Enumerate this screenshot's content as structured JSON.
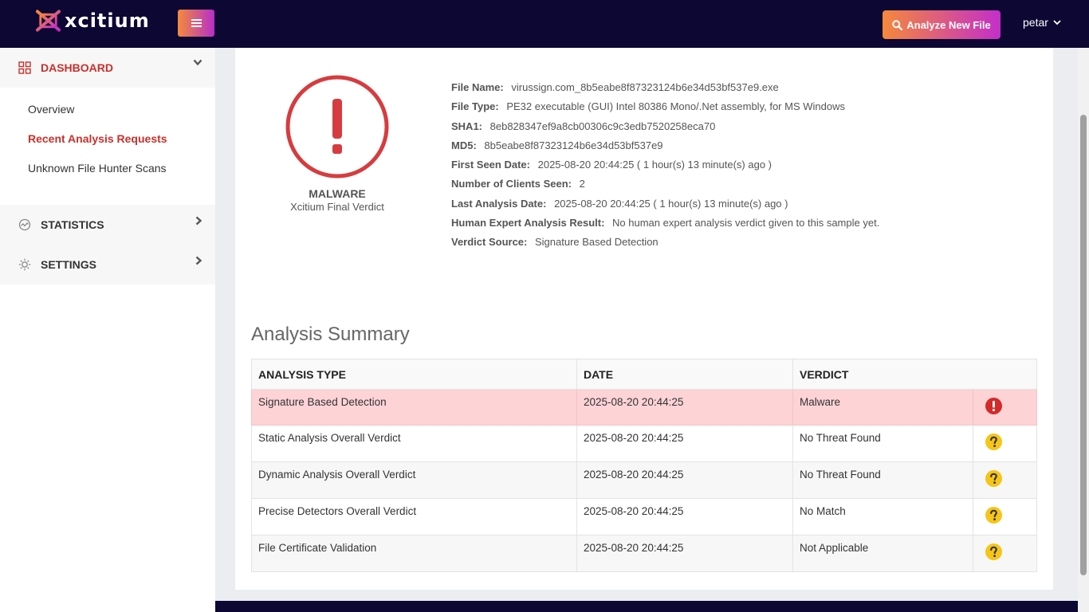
{
  "header": {
    "brand": "xcitium",
    "analyze_label": "Analyze New File",
    "user": "petar"
  },
  "sidebar": {
    "dashboard": "DASHBOARD",
    "items": [
      "Overview",
      "Recent Analysis Requests",
      "Unknown File Hunter Scans"
    ],
    "statistics": "STATISTICS",
    "settings": "SETTINGS"
  },
  "verdict": {
    "label": "MALWARE",
    "sub": "Xcitium Final Verdict"
  },
  "file_info": [
    {
      "label": "File Name:",
      "value": "virussign.com_8b5eabe8f87323124b6e34d53bf537e9.exe"
    },
    {
      "label": "File Type:",
      "value": "PE32 executable (GUI) Intel 80386 Mono/.Net assembly, for MS Windows"
    },
    {
      "label": "SHA1:",
      "value": "8eb828347ef9a8cb00306c9c3edb7520258eca70"
    },
    {
      "label": "MD5:",
      "value": "8b5eabe8f87323124b6e34d53bf537e9"
    },
    {
      "label": "First Seen Date:",
      "value": "2025-08-20 20:44:25 ( 1 hour(s) 13 minute(s) ago )"
    },
    {
      "label": "Number of Clients Seen:",
      "value": "2"
    },
    {
      "label": "Last Analysis Date:",
      "value": "2025-08-20 20:44:25 ( 1 hour(s) 13 minute(s) ago )"
    },
    {
      "label": "Human Expert Analysis Result:",
      "value": "No human expert analysis verdict given to this sample yet."
    },
    {
      "label": "Verdict Source:",
      "value": "Signature Based Detection"
    }
  ],
  "summary": {
    "title": "Analysis Summary",
    "columns": [
      "ANALYSIS TYPE",
      "DATE",
      "VERDICT"
    ],
    "rows": [
      {
        "type": "Signature Based Detection",
        "date": "2025-08-20 20:44:25",
        "verdict": "Malware"
      },
      {
        "type": "Static Analysis Overall Verdict",
        "date": "2025-08-20 20:44:25",
        "verdict": "No Threat Found"
      },
      {
        "type": "Dynamic Analysis Overall Verdict",
        "date": "2025-08-20 20:44:25",
        "verdict": "No Threat Found"
      },
      {
        "type": "Precise Detectors Overall Verdict",
        "date": "2025-08-20 20:44:25",
        "verdict": "No Match"
      },
      {
        "type": "File Certificate Validation",
        "date": "2025-08-20 20:44:25",
        "verdict": "Not Applicable"
      }
    ]
  },
  "colors": {
    "navy": "#0c0733",
    "danger": "#d63c3f",
    "warning": "#f5c518",
    "active_red": "#c9302c"
  },
  "icons": [
    "menu-icon",
    "search-icon",
    "chevron-down-icon",
    "dashboard-grid-icon",
    "statistics-icon",
    "settings-gear-icon",
    "chevron-right-icon",
    "exclamation-circle-icon",
    "question-circle-icon"
  ]
}
